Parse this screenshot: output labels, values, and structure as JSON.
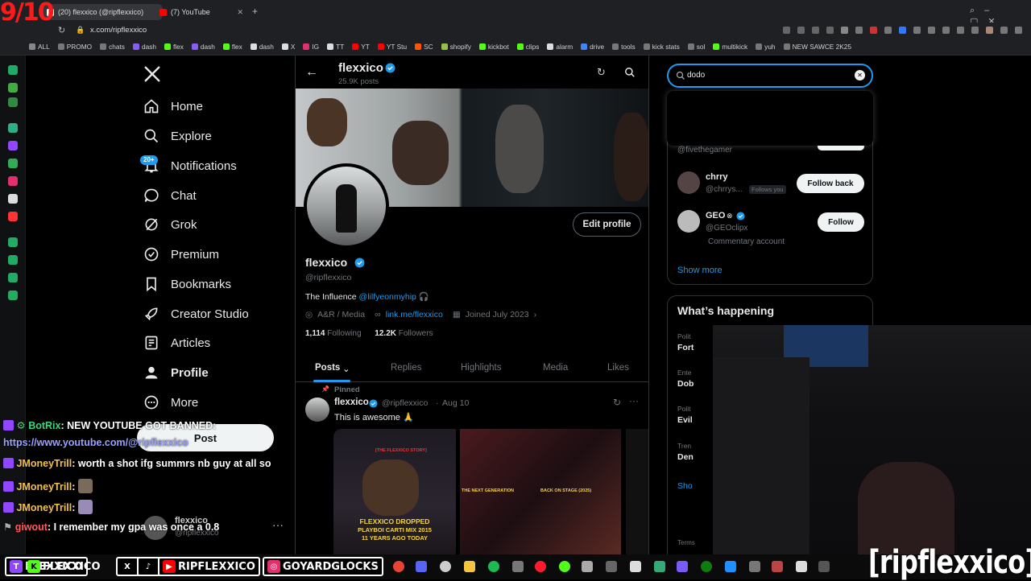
{
  "overlay": {
    "score": "9/10",
    "brand": "[ripflexxico]"
  },
  "browser": {
    "tabs": [
      {
        "label": "(20) flexxico (@ripflexxico)",
        "active": true
      },
      {
        "label": "(7) YouTube",
        "active": false
      }
    ],
    "url": "x.com/ripflexxico",
    "bookmarks": [
      "ALL",
      "PROMO",
      "chats",
      "dash",
      "flex",
      "dash",
      "flex",
      "dash",
      "X",
      "IG",
      "TT",
      "YT",
      "YT Stu",
      "SC",
      "shopify",
      "kickbot",
      "clips",
      "alarm",
      "drive",
      "tools",
      "kick stats",
      "sol",
      "multikick",
      "yuh",
      "NEW SAWCE 2K25"
    ]
  },
  "nav": {
    "items": [
      {
        "label": "Home",
        "icon": "home-icon"
      },
      {
        "label": "Explore",
        "icon": "search-icon"
      },
      {
        "label": "Notifications",
        "icon": "bell-icon",
        "badge": "20+"
      },
      {
        "label": "Chat",
        "icon": "chat-icon"
      },
      {
        "label": "Grok",
        "icon": "grok-icon"
      },
      {
        "label": "Premium",
        "icon": "premium-icon"
      },
      {
        "label": "Bookmarks",
        "icon": "bookmark-icon"
      },
      {
        "label": "Creator Studio",
        "icon": "rocket-icon"
      },
      {
        "label": "Articles",
        "icon": "article-icon"
      },
      {
        "label": "Profile",
        "icon": "person-icon"
      },
      {
        "label": "More",
        "icon": "more-icon"
      }
    ],
    "post_button": "Post",
    "account": {
      "name": "flexxico",
      "handle": "@ripflexxico"
    }
  },
  "profile": {
    "name": "flexxico",
    "posts_count": "25.9K posts",
    "edit_button": "Edit profile",
    "handle": "@ripflexxico",
    "bio_text": "The Influence ",
    "bio_mention": "@lilfyeonmyhip",
    "bio_emoji": "🎧",
    "category": "A&R / Media",
    "link": "link.me/flexxico",
    "joined": "Joined July 2023",
    "following_count": "1,114",
    "following_label": "Following",
    "followers_count": "12.2K",
    "followers_label": "Followers",
    "tabs": [
      "Posts",
      "Replies",
      "Highlights",
      "Media",
      "Likes"
    ],
    "pinned_label": "Pinned",
    "post": {
      "author": "flexxico",
      "handle": "@ripflexxico",
      "date": "Aug 10",
      "text": "This is awesome 🙏",
      "img1_title1": "FLEXXICO DROPPED",
      "img1_title2": "PLAYBOI CARTI MIX 2015",
      "img1_title3": "11 YEARS AGO TODAY",
      "img1_tag": "[THE FLEXXICO STORY]",
      "img2_tag1": "THE NEXT GENERATION",
      "img2_tag2": "BACK ON STAGE (2025)"
    }
  },
  "search": {
    "query": "dodo",
    "who_to_follow": [
      {
        "name": "",
        "handle": "@fivethegamer",
        "button": ""
      },
      {
        "name": "chrry",
        "handle": "@chrrys...",
        "tag": "Follows you",
        "button": "Follow back"
      },
      {
        "name": "GEO",
        "handle": "@GEOclipx",
        "note": "Commentary account",
        "button": "Follow"
      }
    ],
    "show_more": "Show more"
  },
  "whats_happening": {
    "title": "What’s happening",
    "items": [
      {
        "cat": "Polit",
        "topic": "Fort"
      },
      {
        "cat": "Ente",
        "topic": "Dob"
      },
      {
        "cat": "Polit",
        "topic": "Evil"
      },
      {
        "cat": "Tren",
        "topic": "Den"
      }
    ],
    "show": "Sho",
    "terms": "Terms"
  },
  "chat": [
    {
      "user": "BotRix",
      "color": "#3fd37a",
      "text": ": NEW YOUTUBE GOT BANNED:"
    },
    {
      "user": "",
      "color": "#9aa0ff",
      "text": "https://www.youtube.com/@ripflexxico"
    },
    {
      "user": "JMoneyTrill",
      "color": "#f2c14e",
      "text": ": worth a shot ifg summrs nb guy at all so"
    },
    {
      "user": "JMoneyTrill",
      "color": "#f2c14e",
      "text": ":"
    },
    {
      "user": "JMoneyTrill",
      "color": "#f2c14e",
      "text": ":"
    },
    {
      "user": "giwout",
      "color": "#ff5b5b",
      "text": ": I remember my gpa was once a 0.8"
    }
  ],
  "socials": [
    {
      "label": "FLEXXICO",
      "color": "#9146ff",
      "glyph": "T"
    },
    {
      "label": "FLEXXICO",
      "color": "#53fc18",
      "glyph": "K"
    },
    {
      "label": "",
      "color": "#000000",
      "glyph": "X"
    },
    {
      "label": "",
      "color": "#000000",
      "glyph": "♪"
    },
    {
      "label": "RIPFLEXXICO",
      "color": "#ff0000",
      "glyph": "▶"
    },
    {
      "label": "GOYARDGLOCKS",
      "color": "#e1306c",
      "glyph": "◎"
    }
  ]
}
